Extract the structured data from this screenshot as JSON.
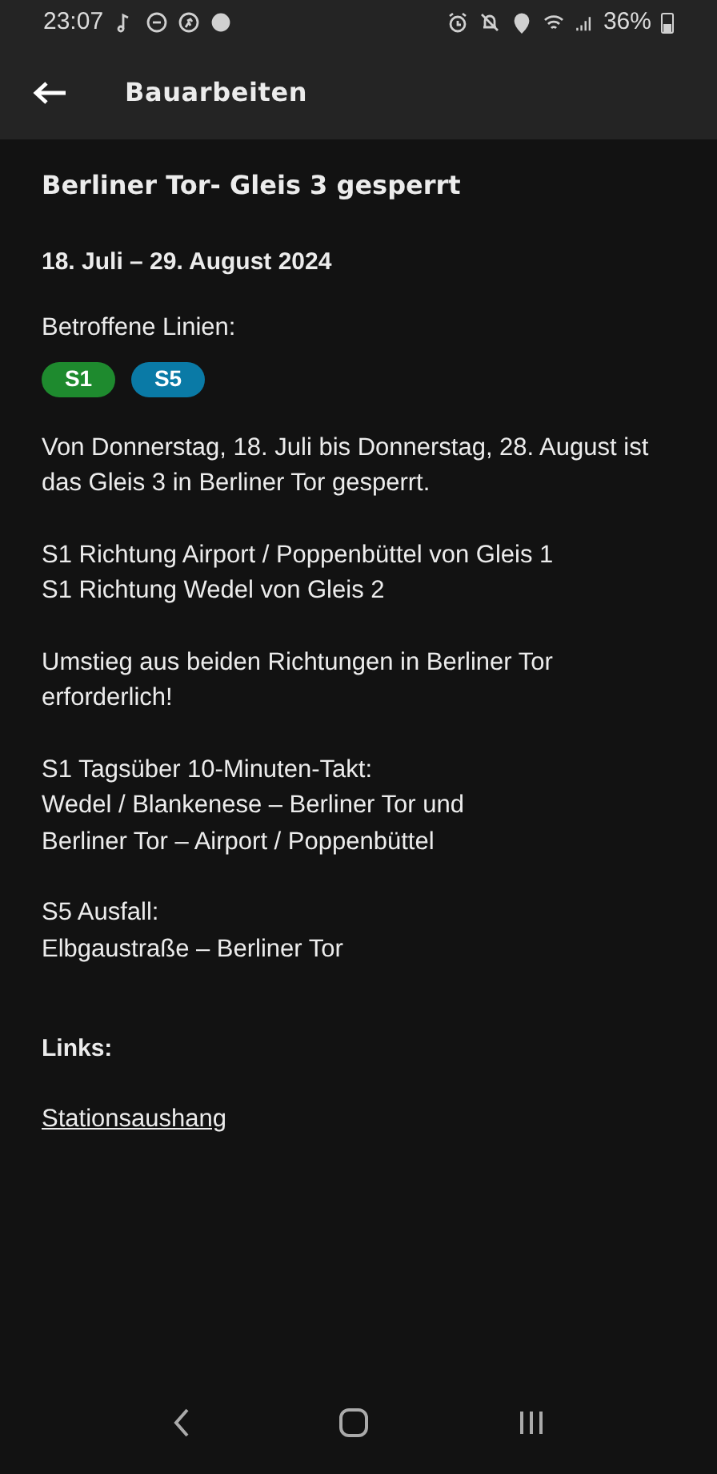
{
  "status_bar": {
    "time": "23:07",
    "battery": "36%"
  },
  "header": {
    "title": "Bauarbeiten"
  },
  "article": {
    "title": "Berliner Tor- Gleis 3 gesperrt",
    "date": "18. Juli – 29. August 2024",
    "lines_label": "Betroffene Linien:",
    "lines": [
      {
        "label": "S1",
        "color": "#1e8a2e"
      },
      {
        "label": "S5",
        "color": "#0a7aa6"
      }
    ],
    "paragraphs": [
      [
        "Von Donnerstag, 18. Juli bis Donnerstag, 28. August ist das Gleis 3 in Berliner Tor gesperrt."
      ],
      [
        "S1 Richtung Airport / Poppenbüttel von Gleis 1",
        "S1 Richtung Wedel von Gleis 2"
      ],
      [
        "Umstieg aus beiden Richtungen in Berliner Tor erforderlich!"
      ],
      [
        "S1 Tagsüber 10-Minuten-Takt:",
        "Wedel / Blankenese – Berliner Tor und",
        "Berliner Tor – Airport / Poppenbüttel"
      ],
      [
        "S5 Ausfall:",
        "Elbgaustraße – Berliner Tor"
      ]
    ],
    "links_label": "Links:",
    "links": [
      "Stationsaushang"
    ]
  }
}
